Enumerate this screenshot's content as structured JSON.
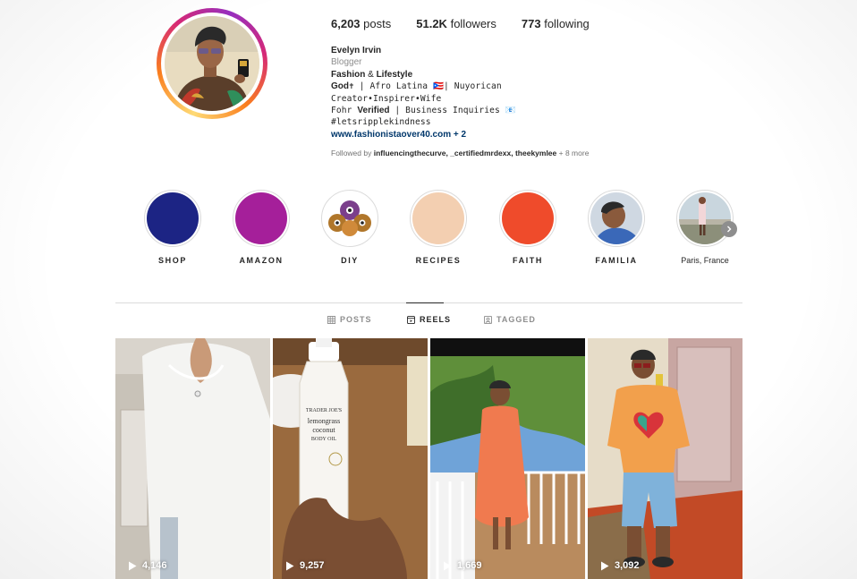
{
  "profile": {
    "posts_count": "6,203",
    "posts_label": "posts",
    "followers_count": "51.2K",
    "followers_label": "followers",
    "following_count": "773",
    "following_label": "following",
    "name": "Evelyn Irvin",
    "category": "Blogger",
    "bio_line1_a": "Fashion",
    "bio_line1_b": " & ",
    "bio_line1_c": "Lifestyle",
    "bio_line2_a": "God",
    "bio_line2_b": "✝ | Afro Latina 🇵🇷| Nuyorican",
    "bio_line3": "Creator•Inspirer•Wife",
    "bio_line4_a": "Fohr ",
    "bio_line4_b": "Verified",
    "bio_line4_c": " | Business Inquiries 📧",
    "bio_line5": "#letsripplekindness",
    "website": "www.fashionistaover40.com",
    "website_more": " + 2",
    "followed_prefix": "Followed by ",
    "followed_names": "influencingthecurve, _certifiedmrdexx, theekymlee",
    "followed_more": " + 8 more"
  },
  "highlights": [
    {
      "label": "SHOP",
      "color": "#1c2484"
    },
    {
      "label": "AMAZON",
      "color": "#a51f9a"
    },
    {
      "label": "DIY",
      "color": "#ffffff"
    },
    {
      "label": "RECIPES",
      "color": "#f3cfb1"
    },
    {
      "label": "FAITH",
      "color": "#ef4b2b"
    },
    {
      "label": "FAMILIA",
      "color": "#5b7fa8"
    },
    {
      "label": "Paris, France",
      "color": "#c9d6de"
    }
  ],
  "tabs": {
    "posts": "POSTS",
    "reels": "REELS",
    "tagged": "TAGGED",
    "active": "reels"
  },
  "reels": [
    {
      "views": "4,146"
    },
    {
      "views": "9,257"
    },
    {
      "views": "1,669"
    },
    {
      "views": "3,092"
    }
  ],
  "icons": {
    "next": "chevron-right-icon",
    "play": "play-icon",
    "grid": "grid-icon",
    "reels": "reels-icon",
    "tagged": "tagged-icon"
  }
}
